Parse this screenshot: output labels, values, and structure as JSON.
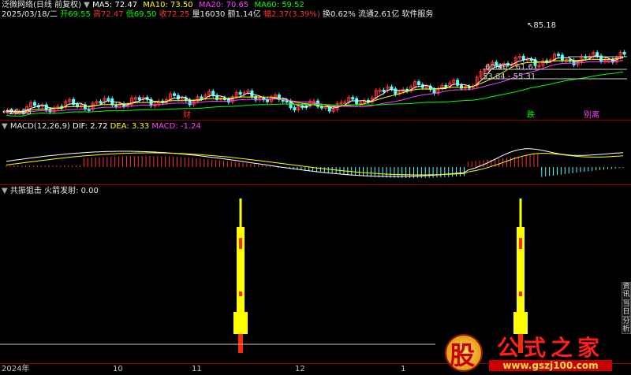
{
  "header": {
    "stock_name": "泛微网络",
    "mode": "(日线 前复权)",
    "ma": [
      {
        "label": "MA5:",
        "value": "72.47",
        "color": "#ffffff"
      },
      {
        "label": "MA10:",
        "value": "73.50",
        "color": "#ffff00"
      },
      {
        "label": "MA20:",
        "value": "70.65",
        "color": "#ff40ff"
      },
      {
        "label": "MA60:",
        "value": "59.52",
        "color": "#00ff00"
      }
    ],
    "date": "2025/03/18/二",
    "open_label": "开",
    "open": "69.55",
    "high_label": "高",
    "high": "72.47",
    "low_label": "低",
    "low": "69.50",
    "close_label": "收",
    "close": "72.25",
    "vol_label": "量",
    "vol": "16030",
    "amt_label": "额",
    "amt": "1.14亿",
    "chg_label": "幅",
    "chg": "2.37(3.39%)",
    "turnover_label": "换",
    "turnover": "0.62%",
    "float_label": "流通",
    "float": "2.61亿",
    "industry": "软件服务"
  },
  "price_panel": {
    "labels": {
      "peak": "85.18",
      "low": "26.33",
      "box_top": "60.80 - 61.61",
      "box_bot": "53.64 - 55.31"
    },
    "signals": {
      "cai": "财",
      "die": "跌",
      "bieli": "别离"
    }
  },
  "macd_panel": {
    "title": "MACD(12,26,9)",
    "dif_label": "DIF:",
    "dif": "2.72",
    "dea_label": "DEA:",
    "dea": "3.33",
    "macd_label": "MACD:",
    "macd": "-1.24"
  },
  "indicator_panel": {
    "title": "共振狙击",
    "name": "火箭发射:",
    "value": "0.00"
  },
  "x_axis": [
    "2024年",
    "10",
    "11",
    "12",
    "1"
  ],
  "side_tabs": [
    "资",
    "讯",
    "当",
    "日",
    "分",
    "析"
  ],
  "watermark": {
    "main": "公式之家",
    "gu": "股",
    "url": "www.gszj100.com"
  },
  "colors": {
    "up": "#ff3232",
    "down": "#54ffff",
    "ma5": "#ffffff",
    "ma10": "#ffff00",
    "ma20": "#ff40ff",
    "ma60": "#00ff00",
    "rocket": "#ffff00"
  }
}
